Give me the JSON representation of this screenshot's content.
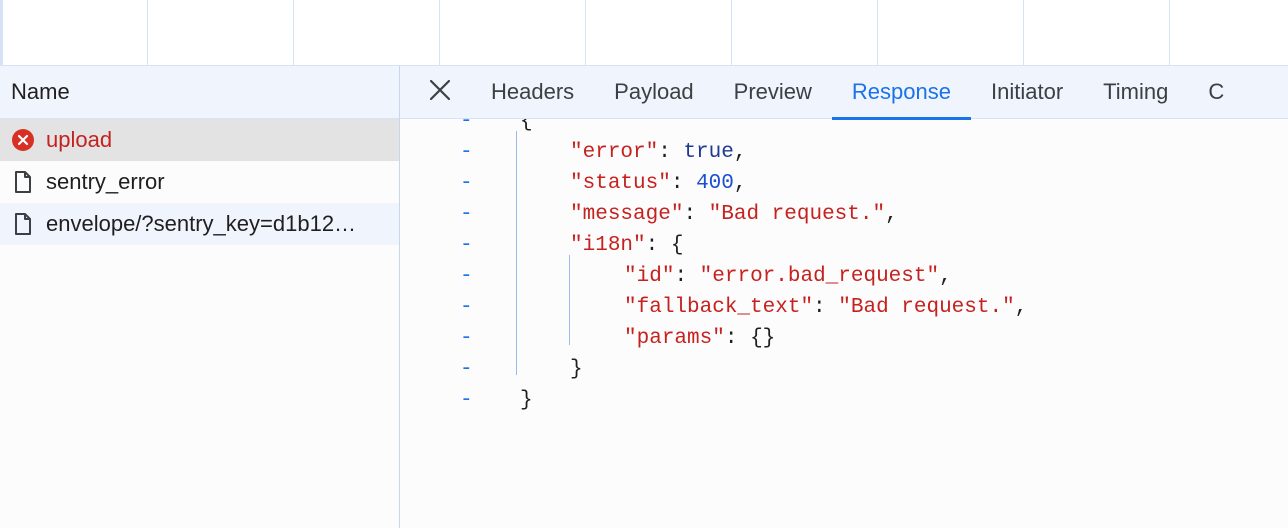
{
  "list": {
    "header": "Name",
    "requests": [
      {
        "name": "upload",
        "icon": "error-circle-icon",
        "status": "error"
      },
      {
        "name": "sentry_error",
        "icon": "document-icon",
        "status": "ok"
      },
      {
        "name": "envelope/?sentry_key=d1b12…",
        "icon": "document-icon",
        "status": "ok"
      }
    ]
  },
  "detail": {
    "close_label": "×",
    "tabs": [
      "Headers",
      "Payload",
      "Preview",
      "Response",
      "Initiator",
      "Timing",
      "C"
    ],
    "active_tab": "Response"
  },
  "response": {
    "gutter_marker": "-",
    "lines": [
      {
        "indent": 0,
        "text": "{"
      },
      {
        "indent": 1,
        "key": "error",
        "value": "true",
        "vtype": "bool",
        "comma": true
      },
      {
        "indent": 1,
        "key": "status",
        "value": "400",
        "vtype": "num",
        "comma": true
      },
      {
        "indent": 1,
        "key": "message",
        "value": "\"Bad request.\"",
        "vtype": "str",
        "comma": true
      },
      {
        "indent": 1,
        "key": "i18n",
        "value": "{",
        "vtype": "punc",
        "comma": false
      },
      {
        "indent": 2,
        "key": "id",
        "value": "\"error.bad_request\"",
        "vtype": "str",
        "comma": true
      },
      {
        "indent": 2,
        "key": "fallback_text",
        "value": "\"Bad request.\"",
        "vtype": "str",
        "comma": true
      },
      {
        "indent": 2,
        "key": "params",
        "value": "{}",
        "vtype": "punc",
        "comma": false
      },
      {
        "indent": 1,
        "text": "}"
      },
      {
        "indent": 0,
        "text": "}"
      }
    ]
  },
  "colors": {
    "accent": "#1a73e8",
    "error": "#c5221f",
    "selected_row": "#e3e3e3",
    "header_bg": "#f0f4fc"
  }
}
